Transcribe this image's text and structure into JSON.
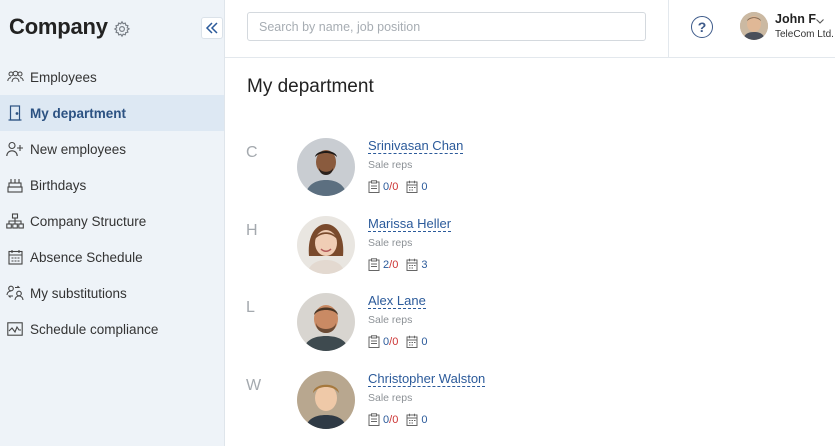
{
  "sidebar": {
    "title": "Company",
    "items": [
      {
        "label": "Employees",
        "icon": "people-icon",
        "active": false
      },
      {
        "label": "My department",
        "icon": "door-icon",
        "active": true
      },
      {
        "label": "New employees",
        "icon": "person-add-icon",
        "active": false
      },
      {
        "label": "Birthdays",
        "icon": "cake-icon",
        "active": false
      },
      {
        "label": "Company Structure",
        "icon": "org-chart-icon",
        "active": false
      },
      {
        "label": "Absence Schedule",
        "icon": "calendar-icon",
        "active": false
      },
      {
        "label": "My substitutions",
        "icon": "substitution-icon",
        "active": false
      },
      {
        "label": "Schedule compliance",
        "icon": "chart-line-icon",
        "active": false
      }
    ]
  },
  "search": {
    "placeholder": "Search by name, job position",
    "value": ""
  },
  "user": {
    "name": "John F",
    "company": "TeleCom Ltd."
  },
  "main": {
    "title": "My department",
    "employees": [
      {
        "letter": "C",
        "name": "Srinivasan Chan",
        "position": "Sale reps",
        "tasks_done": "0",
        "tasks_total": "0",
        "events": "0"
      },
      {
        "letter": "H",
        "name": "Marissa Heller",
        "position": "Sale reps",
        "tasks_done": "2",
        "tasks_total": "0",
        "events": "3"
      },
      {
        "letter": "L",
        "name": "Alex Lane",
        "position": "Sale reps",
        "tasks_done": "0",
        "tasks_total": "0",
        "events": "0"
      },
      {
        "letter": "W",
        "name": "Christopher Walston",
        "position": "Sale reps",
        "tasks_done": "0",
        "tasks_total": "0",
        "events": "0"
      }
    ]
  },
  "colors": {
    "accent": "#2b5a9a",
    "sidebar_bg": "#eef3f8",
    "active_bg": "#dde8f3",
    "overdue": "#cc3333"
  }
}
